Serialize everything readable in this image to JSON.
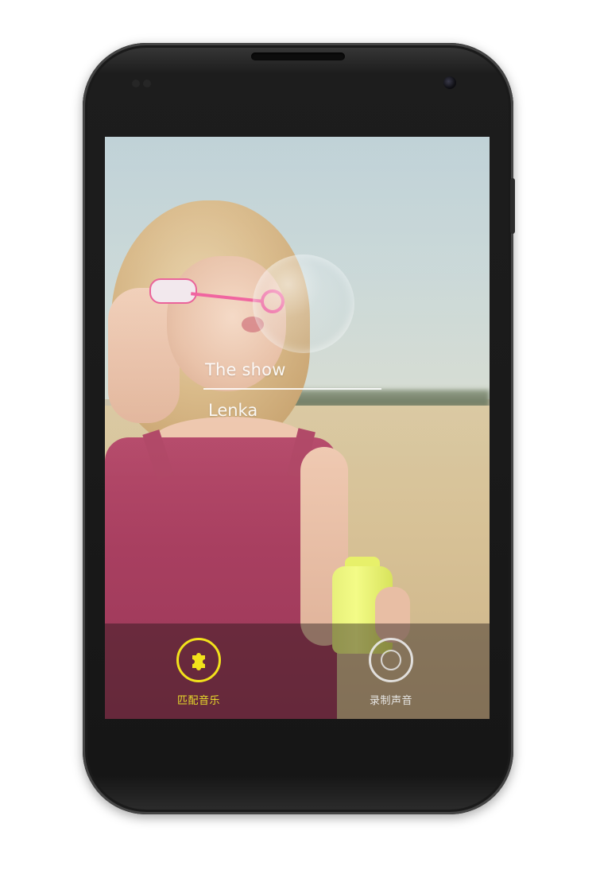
{
  "song": {
    "title": "The show",
    "artist": "Lenka"
  },
  "actions": {
    "match_music": {
      "label": "匹配音乐",
      "icon": "puzzle-icon",
      "color": "#f2e21b"
    },
    "record_sound": {
      "label": "录制声音",
      "icon": "record-icon",
      "color": "#ebebeb"
    }
  },
  "theme": {
    "action_bar_bg": "rgba(28,20,20,0.42)",
    "phone_body": "#1a1a1a"
  }
}
